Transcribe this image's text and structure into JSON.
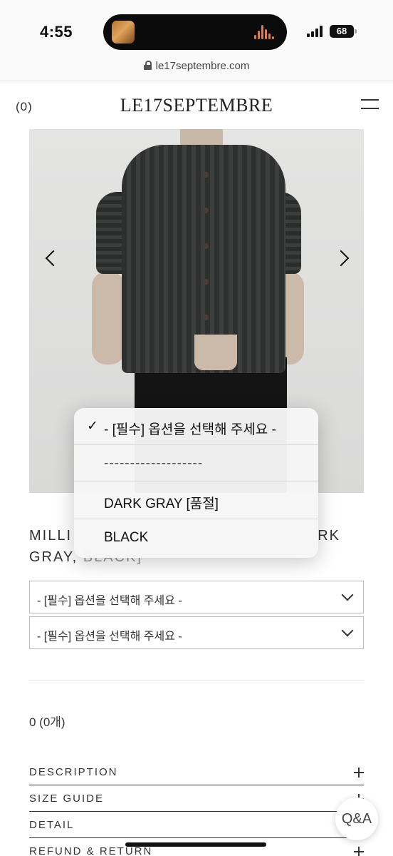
{
  "status_bar": {
    "time": "4:55",
    "battery": "68"
  },
  "browser": {
    "url": "le17septembre.com"
  },
  "header": {
    "cart_count": "(0)",
    "logo": "LE17SEPTEMBRE"
  },
  "product": {
    "title_visible_start": "MILLI",
    "title_visible_end": "RK",
    "title_line2_visible": "GRAY, ",
    "title_line2_obscured": "BLACK]"
  },
  "options": {
    "select1_value": "- [필수] 옵션을 선택해 주세요 -",
    "select2_value": "- [필수] 옵션을 선택해 주세요 -"
  },
  "dropdown": {
    "items": [
      {
        "label": "- [필수] 옵션을 선택해 주세요 -",
        "selected": true
      },
      {
        "label": "-------------------",
        "selected": false
      },
      {
        "label": "DARK GRAY [품절]",
        "selected": false
      },
      {
        "label": "BLACK",
        "selected": false
      }
    ],
    "check_mark": "✓"
  },
  "total": "0 (0개)",
  "accordion": {
    "items": [
      "DESCRIPTION",
      "SIZE GUIDE",
      "DETAIL",
      "REFUND & RETURN"
    ]
  },
  "floating": {
    "qna_label": "Q&A"
  },
  "colors": {
    "accent_wave": "#e07b46",
    "border": "#bcbcbc",
    "text": "#333333"
  }
}
